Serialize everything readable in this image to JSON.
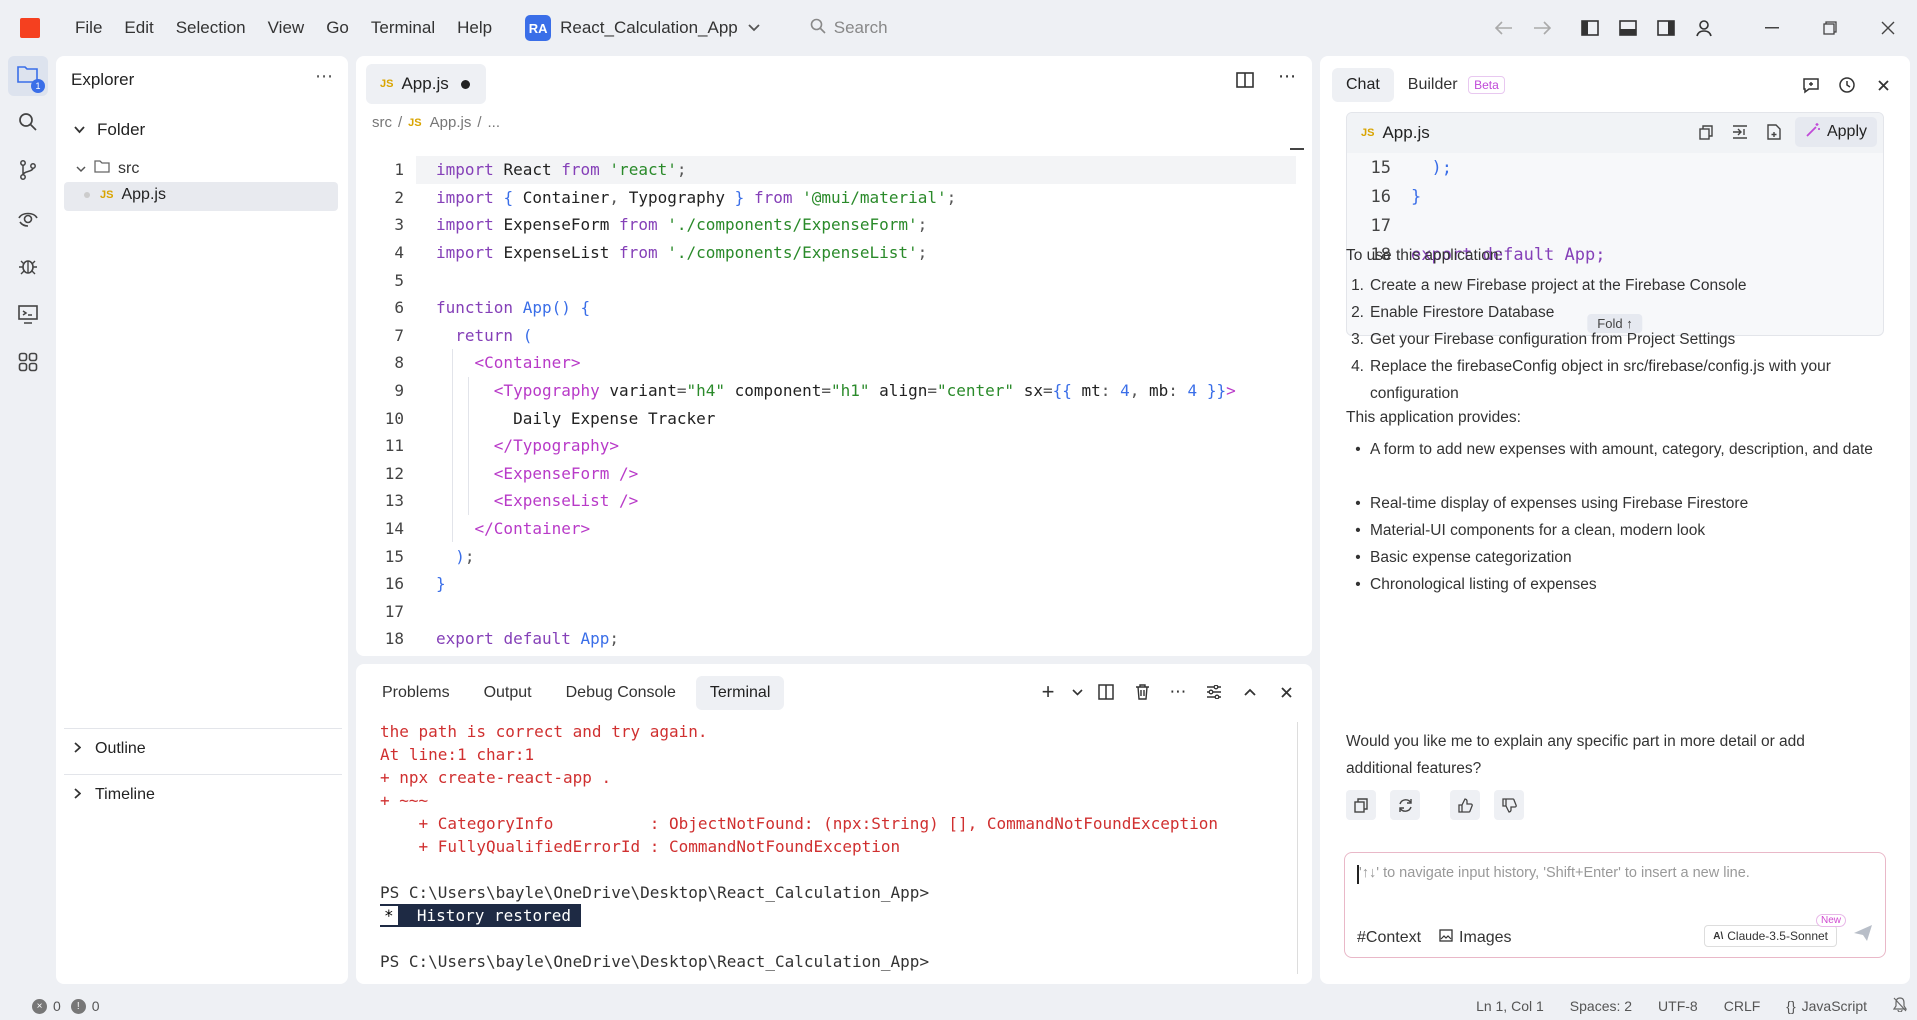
{
  "titlebar": {
    "menu": [
      "File",
      "Edit",
      "Selection",
      "View",
      "Go",
      "Terminal",
      "Help"
    ],
    "project_badge": "RA",
    "project_name": "React_Calculation_App",
    "search_placeholder": "Search"
  },
  "activity": {
    "explorer_badge": "1"
  },
  "explorer": {
    "title": "Explorer",
    "folder_label": "Folder",
    "src_label": "src",
    "file_tag": "JS",
    "file_label": "App.js",
    "outline": "Outline",
    "timeline": "Timeline"
  },
  "editor": {
    "tab_tag": "JS",
    "tab_label": "App.js",
    "breadcrumb": {
      "part1": "src",
      "sep": "/",
      "tag": "JS",
      "part2": "App.js",
      "part3": "..."
    },
    "line_numbers": [
      "1",
      "2",
      "3",
      "4",
      "5",
      "6",
      "7",
      "8",
      "9",
      "10",
      "11",
      "12",
      "13",
      "14",
      "15",
      "16",
      "17",
      "18"
    ],
    "lines": [
      "import React from 'react';",
      "import { Container, Typography } from '@mui/material';",
      "import ExpenseForm from './components/ExpenseForm';",
      "import ExpenseList from './components/ExpenseList';",
      "",
      "function App() {",
      "  return (",
      "    <Container>",
      "      <Typography variant=\"h4\" component=\"h1\" align=\"center\" sx={{ mt: 4, mb: 4 }}>",
      "        Daily Expense Tracker",
      "      </Typography>",
      "      <ExpenseForm />",
      "      <ExpenseList />",
      "    </Container>",
      "  );",
      "}",
      "",
      "export default App;"
    ]
  },
  "panel": {
    "tabs": [
      "Problems",
      "Output",
      "Debug Console",
      "Terminal"
    ],
    "terminal_lines": [
      {
        "text": "the path is correct and try again.",
        "kind": "err"
      },
      {
        "text": "At line:1 char:1",
        "kind": "err"
      },
      {
        "text": "+ npx create-react-app .",
        "kind": "err"
      },
      {
        "text": "+ ~~~",
        "kind": "err"
      },
      {
        "text": "    + CategoryInfo          : ObjectNotFound: (npx:String) [], CommandNotFoundException",
        "kind": "err"
      },
      {
        "text": "    + FullyQualifiedErrorId : CommandNotFoundException",
        "kind": "err"
      },
      {
        "text": "",
        "kind": "norm"
      },
      {
        "text": "PS C:\\Users\\bayle\\OneDrive\\Desktop\\React_Calculation_App>",
        "kind": "norm"
      }
    ],
    "history_star": "*",
    "history_text": "  History restored ",
    "final_prompt": "PS C:\\Users\\bayle\\OneDrive\\Desktop\\React_Calculation_App>"
  },
  "chat": {
    "tab_chat": "Chat",
    "tab_builder": "Builder",
    "beta": "Beta",
    "card_tag": "JS",
    "card_file": "App.js",
    "apply": "Apply",
    "fold": "Fold ↑",
    "card_lines": [
      {
        "n": "15",
        "t": "  );"
      },
      {
        "n": "16",
        "t": "}"
      },
      {
        "n": "17",
        "t": ""
      },
      {
        "n": "18",
        "t": "export default App;"
      }
    ],
    "intro": "To use this application:",
    "steps": [
      "Create a new Firebase project at the Firebase Console",
      "Enable Firestore Database",
      "Get your Firebase configuration from Project Settings",
      "Replace the firebaseConfig object in src/firebase/config.js with your configuration"
    ],
    "provides": "This application provides:",
    "features": [
      "A form to add new expenses with amount, category, description, and date",
      "Real-time display of expenses using Firebase Firestore",
      "Material-UI components for a clean, modern look",
      "Basic expense categorization",
      "Chronological listing of expenses"
    ],
    "question": "Would you like me to explain any specific part in more detail or add additional features?",
    "input_placeholder": "'↑↓' to navigate input history, 'Shift+Enter' to insert a new line.",
    "context": "#Context",
    "images": "Images",
    "model": "Claude-3.5-Sonnet",
    "new_tag": "New"
  },
  "status": {
    "errors": "0",
    "warnings": "0",
    "position": "Ln 1, Col 1",
    "spaces": "Spaces: 2",
    "encoding": "UTF-8",
    "eol": "CRLF",
    "language": "JavaScript"
  }
}
